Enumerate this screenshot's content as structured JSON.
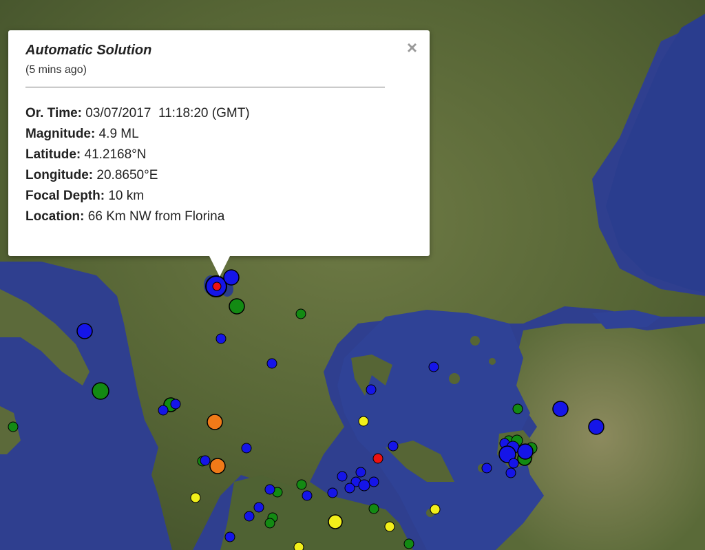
{
  "popup": {
    "title": "Automatic Solution",
    "subtitle": "(5 mins ago)",
    "close_glyph": "×",
    "fields": [
      {
        "label": "Or. Time:",
        "value": " 03/07/2017  11:18:20 (GMT)"
      },
      {
        "label": "Magnitude:",
        "value": " 4.9 ML"
      },
      {
        "label": "Latitude:",
        "value": " 41.2168°N"
      },
      {
        "label": "Longitude:",
        "value": " 20.8650°E"
      },
      {
        "label": "Focal Depth:",
        "value": " 10 km"
      },
      {
        "label": "Location:",
        "value": " 66 Km NW from Florina"
      }
    ]
  },
  "map": {
    "sea_color": "#2f3f8f",
    "land_color": "#5f6f3a",
    "marker_colors": {
      "blue": "#1515e8",
      "green": "#138a13",
      "yellow": "#f2ef1a",
      "orange": "#f07a18",
      "red": "#ee1111"
    }
  }
}
